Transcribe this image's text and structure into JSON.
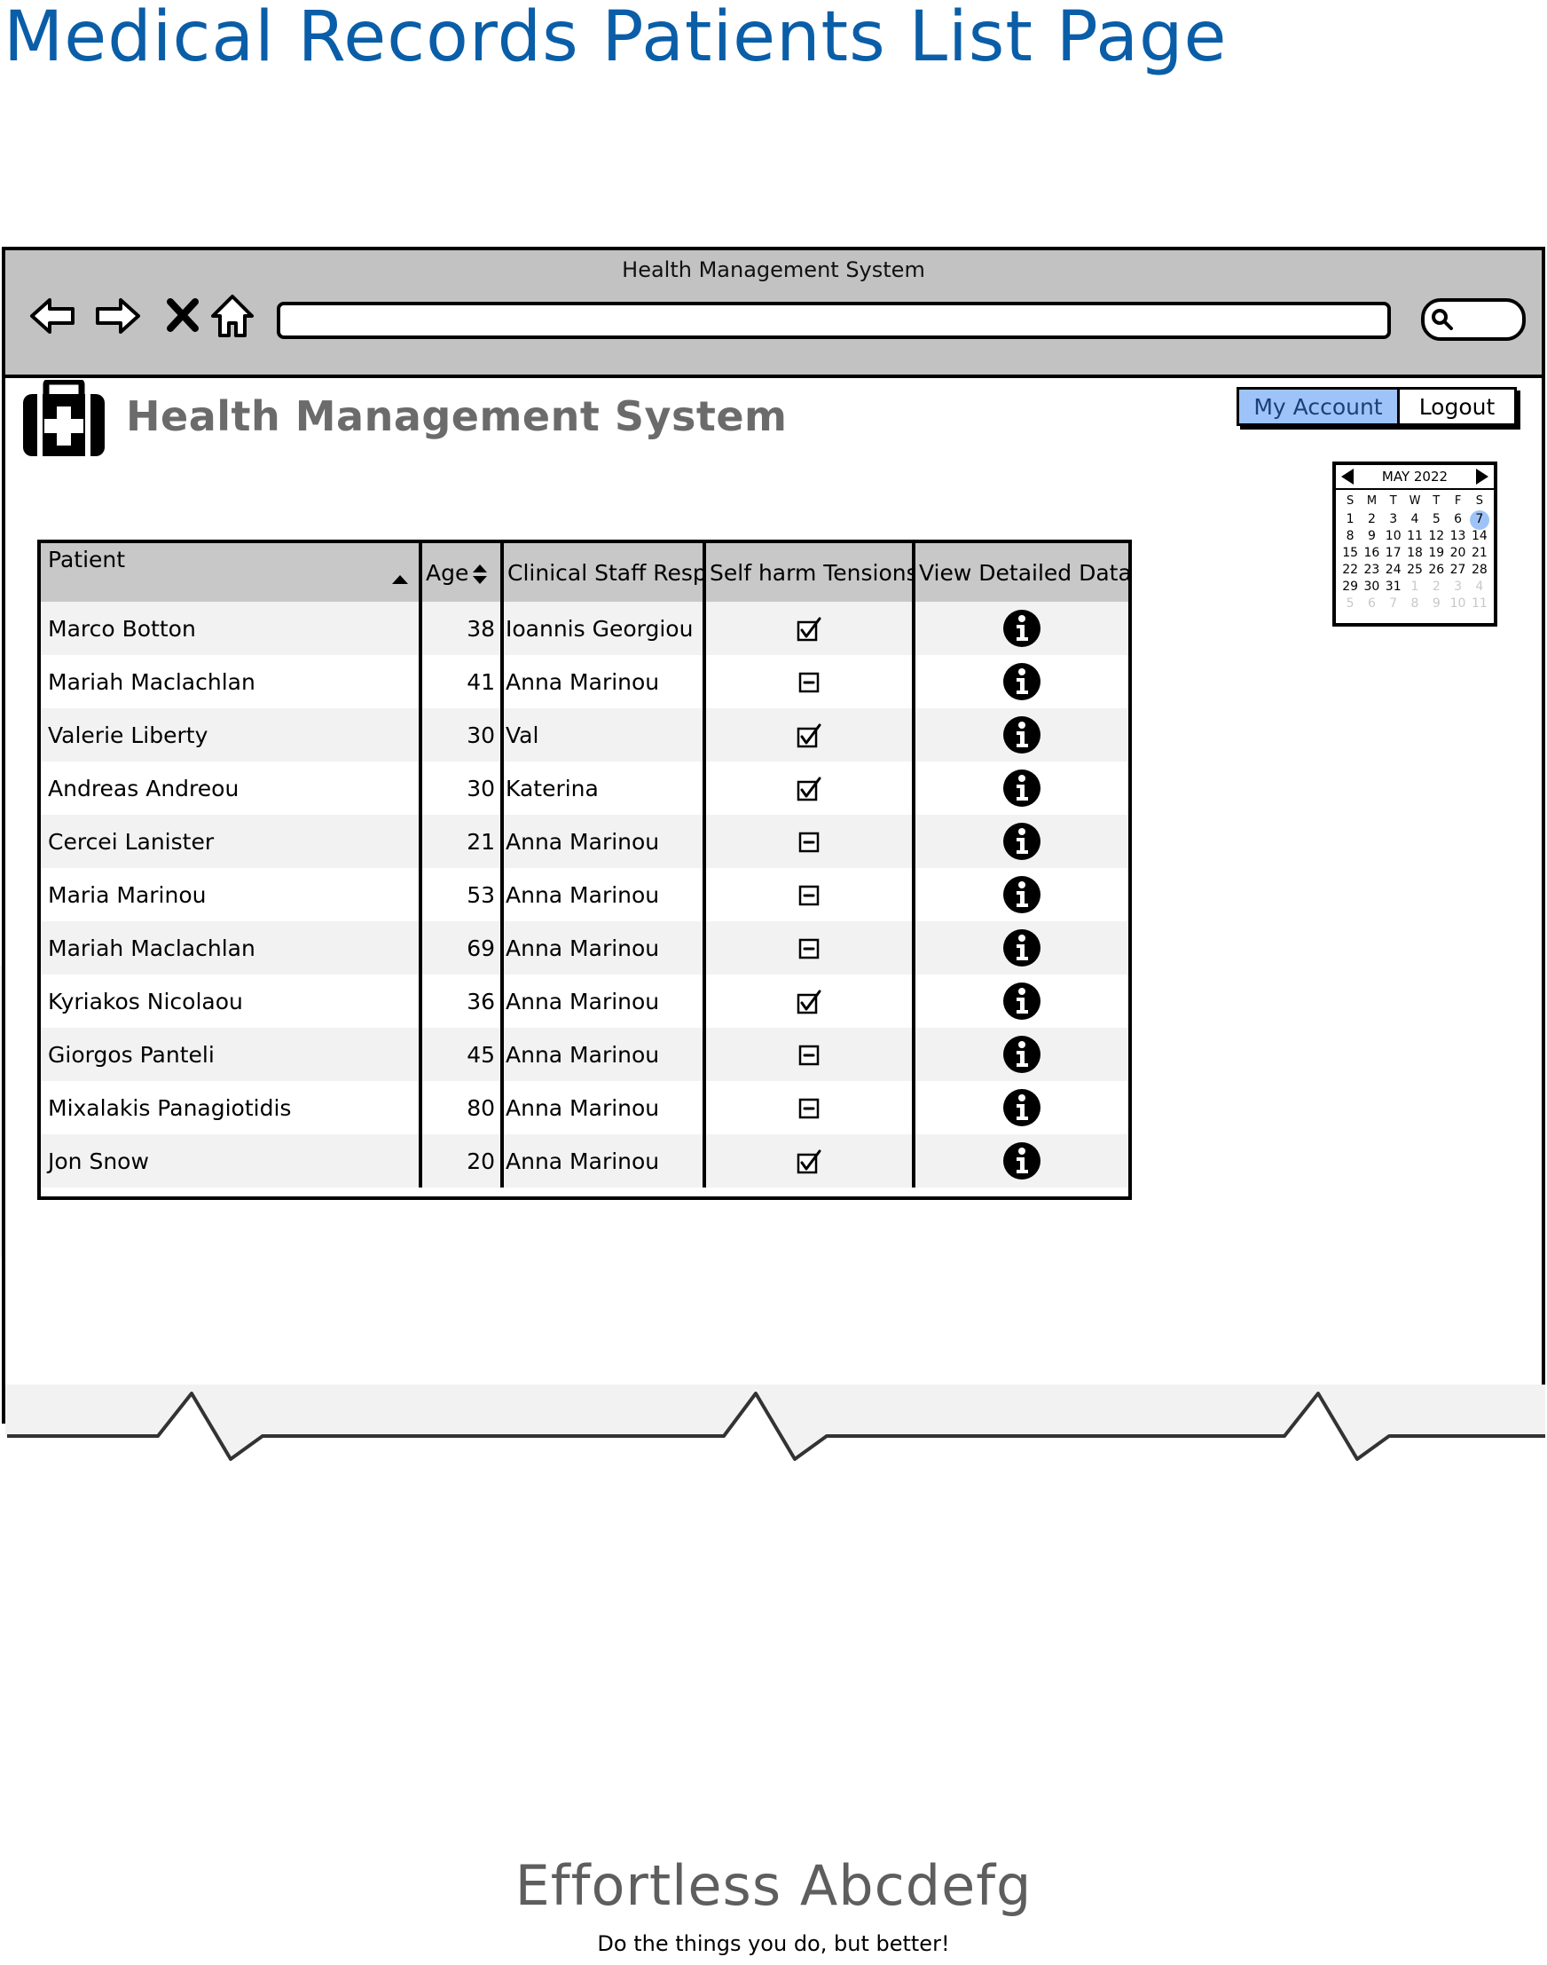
{
  "page": {
    "title": "Medical Records Patients List Page"
  },
  "browser": {
    "window_title": "Health Management System",
    "address_value": "",
    "nav_icons": [
      "back-arrow-icon",
      "forward-arrow-icon",
      "stop-icon",
      "home-icon"
    ],
    "search_icon": "magnifier-icon"
  },
  "app": {
    "logo_icon": "medical-kit-icon",
    "title": "Health Management System",
    "my_account_label": "My Account",
    "logout_label": "Logout",
    "colors": {
      "accent_button": "#9ec3f8",
      "title_blue": "#0a5ea8",
      "header_gray": "#c8c8c8",
      "row_stripe": "#f2f2f2"
    }
  },
  "calendar": {
    "month_label": "MAY 2022",
    "weekdays": [
      "S",
      "M",
      "T",
      "W",
      "T",
      "F",
      "S"
    ],
    "days": [
      {
        "d": "1",
        "muted": false
      },
      {
        "d": "2",
        "muted": false
      },
      {
        "d": "3",
        "muted": false
      },
      {
        "d": "4",
        "muted": false
      },
      {
        "d": "5",
        "muted": false
      },
      {
        "d": "6",
        "muted": false
      },
      {
        "d": "7",
        "muted": false,
        "today": true
      },
      {
        "d": "8",
        "muted": false
      },
      {
        "d": "9",
        "muted": false
      },
      {
        "d": "10",
        "muted": false
      },
      {
        "d": "11",
        "muted": false
      },
      {
        "d": "12",
        "muted": false
      },
      {
        "d": "13",
        "muted": false
      },
      {
        "d": "14",
        "muted": false
      },
      {
        "d": "15",
        "muted": false
      },
      {
        "d": "16",
        "muted": false
      },
      {
        "d": "17",
        "muted": false
      },
      {
        "d": "18",
        "muted": false
      },
      {
        "d": "19",
        "muted": false
      },
      {
        "d": "20",
        "muted": false
      },
      {
        "d": "21",
        "muted": false
      },
      {
        "d": "22",
        "muted": false
      },
      {
        "d": "23",
        "muted": false
      },
      {
        "d": "24",
        "muted": false
      },
      {
        "d": "25",
        "muted": false
      },
      {
        "d": "26",
        "muted": false
      },
      {
        "d": "27",
        "muted": false
      },
      {
        "d": "28",
        "muted": false
      },
      {
        "d": "29",
        "muted": false
      },
      {
        "d": "30",
        "muted": false
      },
      {
        "d": "31",
        "muted": false
      },
      {
        "d": "1",
        "muted": true
      },
      {
        "d": "2",
        "muted": true
      },
      {
        "d": "3",
        "muted": true
      },
      {
        "d": "4",
        "muted": true
      },
      {
        "d": "5",
        "muted": true
      },
      {
        "d": "6",
        "muted": true
      },
      {
        "d": "7",
        "muted": true
      },
      {
        "d": "8",
        "muted": true
      },
      {
        "d": "9",
        "muted": true
      },
      {
        "d": "10",
        "muted": true
      },
      {
        "d": "11",
        "muted": true
      }
    ]
  },
  "table": {
    "headers": {
      "patient": "Patient",
      "age": "Age",
      "staff": "Clinical Staff Resp",
      "self_harm": "Self harm Tensions",
      "details": "View Detailed Data"
    },
    "sort_icons": {
      "patient": "sort-ascending-icon",
      "age": "sort-both-icon"
    },
    "rows": [
      {
        "patient": "Marco Botton",
        "age": "38",
        "staff": "Ioannis Georgiou",
        "self_harm": true
      },
      {
        "patient": "Mariah Maclachlan",
        "age": "41",
        "staff": "Anna Marinou",
        "self_harm": false
      },
      {
        "patient": "Valerie Liberty",
        "age": "30",
        "staff": "Val",
        "self_harm": true
      },
      {
        "patient": "Andreas Andreou",
        "age": "30",
        "staff": "Katerina",
        "self_harm": true
      },
      {
        "patient": "Cercei Lanister",
        "age": "21",
        "staff": "Anna Marinou",
        "self_harm": false
      },
      {
        "patient": "Maria Marinou",
        "age": "53",
        "staff": "Anna Marinou",
        "self_harm": false
      },
      {
        "patient": "Mariah Maclachlan",
        "age": "69",
        "staff": "Anna Marinou",
        "self_harm": false
      },
      {
        "patient": "Kyriakos Nicolaou",
        "age": "36",
        "staff": "Anna Marinou",
        "self_harm": true
      },
      {
        "patient": "Giorgos Panteli",
        "age": "45",
        "staff": "Anna Marinou",
        "self_harm": false
      },
      {
        "patient": "Mixalakis Panagiotidis",
        "age": "80",
        "staff": "Anna Marinou",
        "self_harm": false
      },
      {
        "patient": "Jon Snow",
        "age": "20",
        "staff": "Anna Marinou",
        "self_harm": true
      }
    ]
  },
  "footer": {
    "brand": "Effortless Abcdefg",
    "tagline": "Do the things you do, but better!"
  }
}
